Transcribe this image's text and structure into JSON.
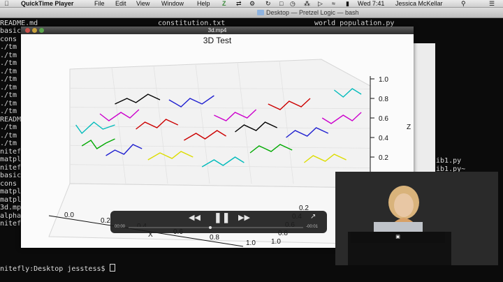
{
  "menubar": {
    "app": "QuickTime Player",
    "items": [
      "File",
      "Edit",
      "View",
      "Window",
      "Help"
    ],
    "clock": "Wed 7:41",
    "user": "Jessica McKellar"
  },
  "terminal": {
    "title": "Desktop — Pretzel Logic — bash",
    "tab_files": [
      "README.md",
      "constitution.txt",
      "world_population.py"
    ],
    "left_lines": [
      "basic",
      "cons",
      "./tm",
      "./tm",
      "./tm",
      "./tm",
      "./tm",
      "./tm",
      "./tm",
      "./tm",
      "./tm",
      "README",
      "./tm",
      "./tm",
      "./tm",
      "nitef",
      "matpl",
      "nitef",
      "basic",
      "cons",
      "matpl",
      "matpl",
      "3d.mp4",
      "alpha_he",
      "nitefly"
    ],
    "right_lines": [
      "lib1.py",
      "lib1.py~"
    ],
    "prompt": "nitefly:Desktop jesstess$ "
  },
  "video": {
    "window_title": "3d.mp4",
    "time_elapsed": "00:00",
    "time_remaining": "-00:01",
    "icons": [
      "rewind-icon",
      "pause-icon",
      "fast-forward-icon",
      "share-icon"
    ]
  },
  "chart_data": {
    "type": "line",
    "title": "3D Test",
    "xlabel": "X",
    "ylabel": "",
    "zlabel": "Z",
    "x_ticks": [
      "0.0",
      "0.2",
      "0.4",
      "0.6",
      "0.8",
      "1.0"
    ],
    "y_ticks": [
      "1.0",
      "0.8",
      "0.6",
      "0.4",
      "0.2"
    ],
    "z_ticks": [
      "1.0",
      "0.8",
      "0.6",
      "0.4",
      "0.2",
      "0.0"
    ],
    "series_colors": [
      "#000000",
      "#1f1fd0",
      "#cc0000",
      "#00aa00",
      "#cc00cc",
      "#00bbbb",
      "#dddd00"
    ],
    "series": [
      {
        "color": "#00bbbb",
        "points": [
          [
            0.02,
            0.55
          ],
          [
            0.04,
            0.49
          ],
          [
            0.08,
            0.57
          ],
          [
            0.11,
            0.52
          ],
          [
            0.15,
            0.55
          ]
        ]
      },
      {
        "color": "#1f1fd0",
        "points": [
          [
            0.12,
            0.33
          ],
          [
            0.15,
            0.37
          ],
          [
            0.18,
            0.34
          ],
          [
            0.21,
            0.41
          ],
          [
            0.24,
            0.38
          ]
        ]
      },
      {
        "color": "#00aa00",
        "points": [
          [
            0.04,
            0.4
          ],
          [
            0.07,
            0.44
          ],
          [
            0.09,
            0.38
          ],
          [
            0.12,
            0.42
          ],
          [
            0.15,
            0.45
          ]
        ]
      },
      {
        "color": "#cc00cc",
        "points": [
          [
            0.1,
            0.63
          ],
          [
            0.13,
            0.58
          ],
          [
            0.17,
            0.64
          ],
          [
            0.2,
            0.6
          ],
          [
            0.23,
            0.66
          ]
        ]
      },
      {
        "color": "#000000",
        "points": [
          [
            0.15,
            0.7
          ],
          [
            0.19,
            0.74
          ],
          [
            0.22,
            0.71
          ],
          [
            0.26,
            0.77
          ],
          [
            0.3,
            0.73
          ]
        ]
      },
      {
        "color": "#cc0000",
        "points": [
          [
            0.22,
            0.52
          ],
          [
            0.25,
            0.57
          ],
          [
            0.29,
            0.53
          ],
          [
            0.32,
            0.59
          ],
          [
            0.36,
            0.55
          ]
        ]
      },
      {
        "color": "#dddd00",
        "points": [
          [
            0.26,
            0.3
          ],
          [
            0.3,
            0.35
          ],
          [
            0.34,
            0.31
          ],
          [
            0.37,
            0.36
          ],
          [
            0.41,
            0.32
          ]
        ]
      },
      {
        "color": "#1f1fd0",
        "points": [
          [
            0.33,
            0.73
          ],
          [
            0.37,
            0.68
          ],
          [
            0.4,
            0.74
          ],
          [
            0.44,
            0.7
          ],
          [
            0.48,
            0.76
          ]
        ]
      },
      {
        "color": "#cc0000",
        "points": [
          [
            0.38,
            0.44
          ],
          [
            0.42,
            0.49
          ],
          [
            0.45,
            0.45
          ],
          [
            0.49,
            0.51
          ],
          [
            0.52,
            0.47
          ]
        ]
      },
      {
        "color": "#00bbbb",
        "points": [
          [
            0.44,
            0.25
          ],
          [
            0.48,
            0.3
          ],
          [
            0.51,
            0.26
          ],
          [
            0.55,
            0.32
          ],
          [
            0.58,
            0.28
          ]
        ]
      },
      {
        "color": "#cc00cc",
        "points": [
          [
            0.48,
            0.62
          ],
          [
            0.52,
            0.58
          ],
          [
            0.55,
            0.64
          ],
          [
            0.59,
            0.6
          ],
          [
            0.62,
            0.66
          ]
        ]
      },
      {
        "color": "#000000",
        "points": [
          [
            0.55,
            0.5
          ],
          [
            0.58,
            0.55
          ],
          [
            0.62,
            0.51
          ],
          [
            0.65,
            0.57
          ],
          [
            0.69,
            0.53
          ]
        ]
      },
      {
        "color": "#00aa00",
        "points": [
          [
            0.6,
            0.35
          ],
          [
            0.63,
            0.4
          ],
          [
            0.67,
            0.36
          ],
          [
            0.7,
            0.41
          ],
          [
            0.74,
            0.37
          ]
        ]
      },
      {
        "color": "#cc0000",
        "points": [
          [
            0.66,
            0.7
          ],
          [
            0.7,
            0.66
          ],
          [
            0.73,
            0.72
          ],
          [
            0.77,
            0.68
          ],
          [
            0.8,
            0.74
          ]
        ]
      },
      {
        "color": "#1f1fd0",
        "points": [
          [
            0.72,
            0.46
          ],
          [
            0.75,
            0.51
          ],
          [
            0.79,
            0.47
          ],
          [
            0.82,
            0.53
          ],
          [
            0.86,
            0.49
          ]
        ]
      },
      {
        "color": "#dddd00",
        "points": [
          [
            0.78,
            0.28
          ],
          [
            0.81,
            0.33
          ],
          [
            0.85,
            0.29
          ],
          [
            0.88,
            0.34
          ],
          [
            0.92,
            0.3
          ]
        ]
      },
      {
        "color": "#cc00cc",
        "points": [
          [
            0.84,
            0.6
          ],
          [
            0.87,
            0.56
          ],
          [
            0.91,
            0.62
          ],
          [
            0.94,
            0.58
          ],
          [
            0.97,
            0.64
          ]
        ]
      },
      {
        "color": "#00bbbb",
        "points": [
          [
            0.88,
            0.8
          ],
          [
            0.91,
            0.75
          ],
          [
            0.94,
            0.81
          ],
          [
            0.97,
            0.77
          ]
        ]
      }
    ]
  }
}
